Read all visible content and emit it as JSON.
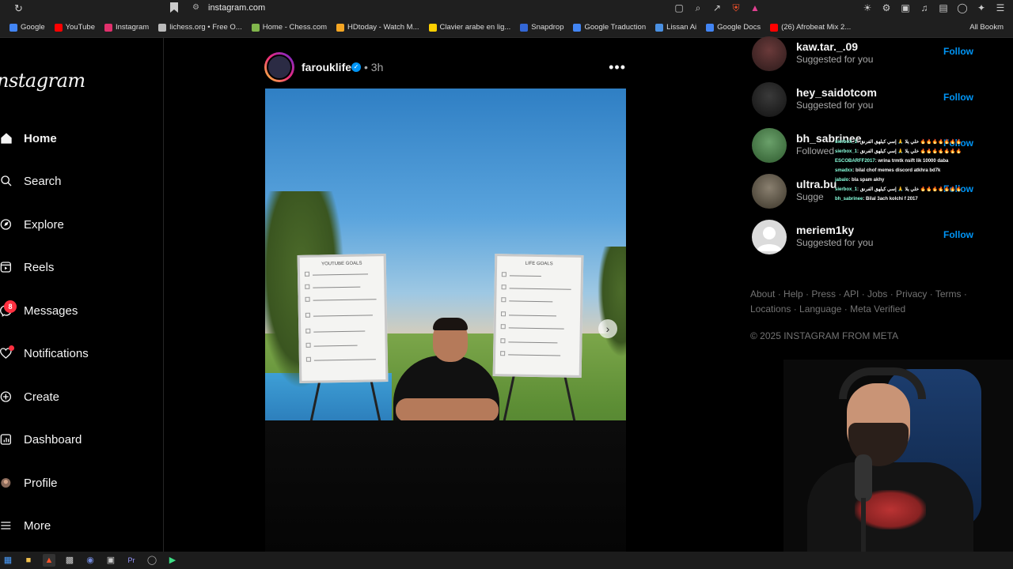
{
  "browser": {
    "url": "instagram.com",
    "bookmarks": [
      {
        "label": "Google",
        "color": "#4285f4"
      },
      {
        "label": "YouTube",
        "color": "#ff0000"
      },
      {
        "label": "Instagram",
        "color": "#e1306c"
      },
      {
        "label": "lichess.org • Free O...",
        "color": "#bbbbbb"
      },
      {
        "label": "Home - Chess.com",
        "color": "#81b64c"
      },
      {
        "label": "HDtoday - Watch M...",
        "color": "#f5a623"
      },
      {
        "label": "Clavier arabe en lig...",
        "color": "#ffd000"
      },
      {
        "label": "Snapdrop",
        "color": "#3367d6"
      },
      {
        "label": "Google Traduction",
        "color": "#4285f4"
      },
      {
        "label": "Lissan Ai",
        "color": "#4a90e2"
      },
      {
        "label": "Google Docs",
        "color": "#4285f4"
      },
      {
        "label": "(26) Afrobeat Mix 2...",
        "color": "#ff0000"
      }
    ],
    "all_bookmarks": "All Bookm"
  },
  "sidebar": {
    "logo": "Instagram",
    "items": [
      {
        "label": "Home",
        "icon": "home-icon"
      },
      {
        "label": "Search",
        "icon": "search-icon"
      },
      {
        "label": "Explore",
        "icon": "compass-icon"
      },
      {
        "label": "Reels",
        "icon": "reels-icon"
      },
      {
        "label": "Messages",
        "icon": "messenger-icon",
        "badge": "8"
      },
      {
        "label": "Notifications",
        "icon": "heart-icon"
      },
      {
        "label": "Create",
        "icon": "plus-square-icon"
      },
      {
        "label": "Dashboard",
        "icon": "dashboard-icon"
      },
      {
        "label": "Profile",
        "icon": "avatar-icon"
      },
      {
        "label": "More",
        "icon": "menu-icon"
      }
    ]
  },
  "post": {
    "username": "farouklife",
    "time": "3h",
    "left_board_title": "YOUTUBE GOALS",
    "right_board_title": "LIFE GOALS"
  },
  "suggestions": [
    {
      "name": "kaw.tar._.09",
      "sub": "Suggested for you",
      "action": "Follow"
    },
    {
      "name": "hey_saidotcom",
      "sub": "Suggested for you",
      "action": "Follow"
    },
    {
      "name": "bh_sabrinee",
      "sub": "Followed",
      "action": "Follow"
    },
    {
      "name": "ultra.bu",
      "sub": "Sugge",
      "action": "Follow"
    },
    {
      "name": "meriem1ky",
      "sub": "Suggested for you",
      "action": "Follow"
    }
  ],
  "footer": {
    "links": "About · Help · Press · API · Jobs · Privacy · Terms · Locations · Language · Meta Verified",
    "copyright": "© 2025 INSTAGRAM FROM META"
  },
  "chat": [
    {
      "user": "sierbox_1",
      "text": ": خلي يلا 🙏 إسي كيلهق الفرنق 🔥🔥🔥🔥🔥🔥🔥"
    },
    {
      "user": "sierbox_1",
      "text": ": خلي يلا 🙏 إسي كيلهق الفرنق 🔥🔥🔥🔥🔥🔥🔥"
    },
    {
      "user": "ESCOBARFF2017",
      "text": ": wrina trmtk nsift lik 10000 daba"
    },
    {
      "user": "smadxx",
      "text": ": bilal chof memes discord atkhra bd7k"
    },
    {
      "user": "jabalo",
      "text": ": bla spam akhy"
    },
    {
      "user": "sierbox_1",
      "text": ": خلي يلا 🙏 إسي كيلهق الفرنق 🔥🔥🔥🔥🔥🔥🔥"
    },
    {
      "user": "bh_sabrinee",
      "text": ": Bilal 3ach kolchi f 2017"
    }
  ],
  "colors": {
    "accent": "#0095f6",
    "badge": "#ff3040",
    "muted": "#a8a8a8"
  }
}
